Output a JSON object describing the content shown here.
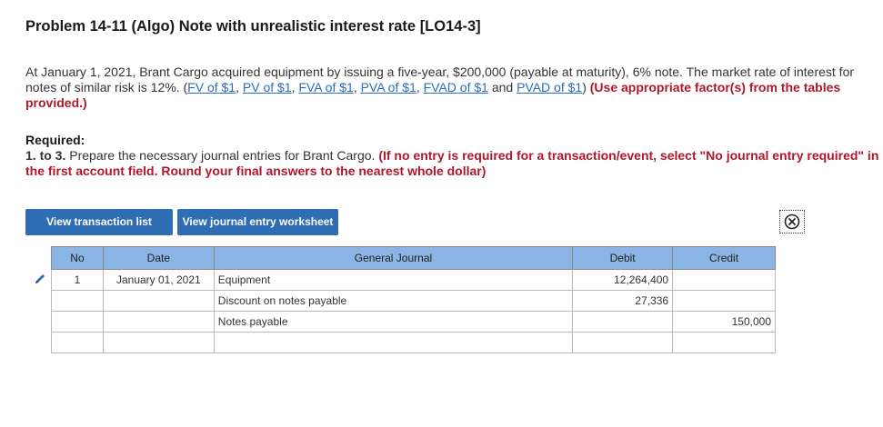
{
  "header": {
    "title": "Problem 14-11 (Algo) Note with unrealistic interest rate [LO14-3]"
  },
  "intro": {
    "text": "At January 1, 2021, Brant Cargo acquired equipment by issuing a five-year, $200,000 (payable at maturity), 6% note. The market rate of interest for notes of similar risk is 12%. (",
    "links": [
      "FV of $1",
      "PV of $1",
      "FVA of $1",
      "PVA of $1",
      "FVAD of $1",
      "PVAD of $1"
    ],
    "sep": ", ",
    "and": " and ",
    "close_paren": ") ",
    "instruction": "(Use appropriate factor(s) from the tables provided.)"
  },
  "required": {
    "heading": "Required:",
    "step": "1. to 3.",
    "text": " Prepare the necessary journal entries for Brant Cargo. ",
    "instruction": "(If no entry is required for a transaction/event, select \"No journal entry required\" in the first account field. Round your final answers to the nearest whole dollar)"
  },
  "buttons": {
    "transaction_list": "View transaction list",
    "journal_worksheet": "View journal entry worksheet"
  },
  "icons": {
    "close": "close-circle-icon",
    "edit": "pencil-icon"
  },
  "colors": {
    "accent": "#2f6db5",
    "header_bg": "#8ab4e3",
    "red_text": "#b0172a",
    "link": "#2a6cbf"
  },
  "table": {
    "headers": [
      "No",
      "Date",
      "General Journal",
      "Debit",
      "Credit"
    ],
    "rows": [
      {
        "no": "1",
        "date": "January 01, 2021",
        "account": "Equipment",
        "debit": "12,264,400",
        "credit": "",
        "indent": false
      },
      {
        "no": "",
        "date": "",
        "account": "Discount on notes payable",
        "debit": "27,336",
        "credit": "",
        "indent": false
      },
      {
        "no": "",
        "date": "",
        "account": "Notes payable",
        "debit": "",
        "credit": "150,000",
        "indent": true
      },
      {
        "no": "",
        "date": "",
        "account": "",
        "debit": "",
        "credit": "",
        "indent": false
      }
    ]
  }
}
